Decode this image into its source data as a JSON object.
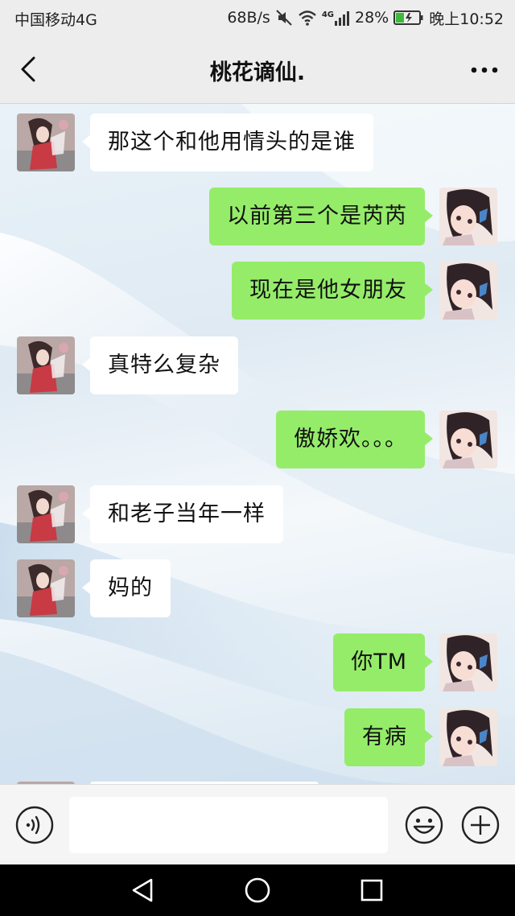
{
  "status_bar": {
    "carrier": "中国移动4G",
    "speed": "68B/s",
    "network": "4G",
    "battery": "28%",
    "time": "晚上10:52",
    "icons": [
      "mute-icon",
      "wifi-icon",
      "signal-icon",
      "battery-icon"
    ]
  },
  "header": {
    "title": "桃花谪仙.",
    "back_icon": "chevron-left-icon",
    "more_icon": "more-dots-icon"
  },
  "messages": [
    {
      "side": "in",
      "text": "那这个和他用情头的是谁"
    },
    {
      "side": "out",
      "text": "以前第三个是芮芮"
    },
    {
      "side": "out",
      "text": "现在是他女朋友"
    },
    {
      "side": "in",
      "text": "真特么复杂"
    },
    {
      "side": "out",
      "text": "傲娇欢。。。"
    },
    {
      "side": "in",
      "text": "和老子当年一样"
    },
    {
      "side": "in",
      "text": "妈的"
    },
    {
      "side": "out",
      "text": "你TM"
    },
    {
      "side": "out",
      "text": "有病"
    }
  ],
  "input_bar": {
    "value": "",
    "icons": [
      "voice-icon",
      "emoji-icon",
      "plus-icon"
    ]
  },
  "system_nav": {
    "icons": [
      "back-triangle-icon",
      "home-circle-icon",
      "recents-square-icon"
    ]
  },
  "colors": {
    "outgoing_bubble": "#95ec69",
    "incoming_bubble": "#ffffff",
    "bar_background": "#ededed"
  }
}
